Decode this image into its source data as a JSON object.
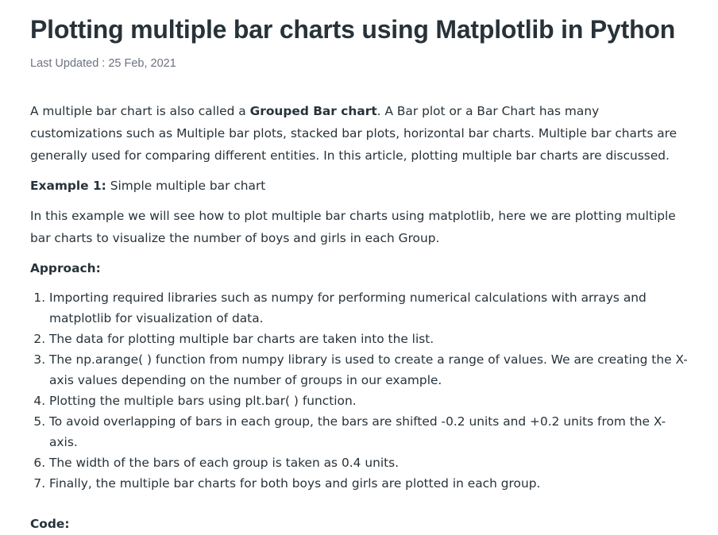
{
  "article": {
    "title": "Plotting multiple bar charts using Matplotlib in Python",
    "last_updated": "Last Updated : 25 Feb, 2021",
    "intro": {
      "before": "A multiple bar chart is also called a ",
      "bold": "Grouped Bar chart",
      "after": ". A Bar plot or a Bar Chart has many customizations such as Multiple bar plots, stacked bar plots, horizontal bar charts. Multiple bar charts are generally used for comparing different entities. In this article, plotting multiple bar charts are discussed."
    },
    "example1": {
      "label": "Example 1:",
      "text": " Simple multiple bar chart"
    },
    "example1_description": "In this example we will see how to plot multiple bar charts using matplotlib, here we are plotting multiple bar charts to visualize the number of boys and girls in each Group.",
    "approach_label": "Approach:",
    "steps": [
      "Importing required libraries such as numpy for performing numerical calculations with arrays and matplotlib for visualization of data.",
      "The data for plotting multiple bar charts are taken into the list.",
      "The np.arange( ) function from numpy library is used to create a range of values. We are creating the X-axis values depending on the number of groups in our example.",
      "Plotting the multiple bars using plt.bar( ) function.",
      "To avoid overlapping of bars in each group, the bars are shifted -0.2 units and +0.2 units from the X-axis.",
      "The width of the bars of each group is taken as 0.4 units.",
      "Finally, the multiple bar charts for both boys and girls are plotted in each group."
    ],
    "code_label": "Code:"
  }
}
